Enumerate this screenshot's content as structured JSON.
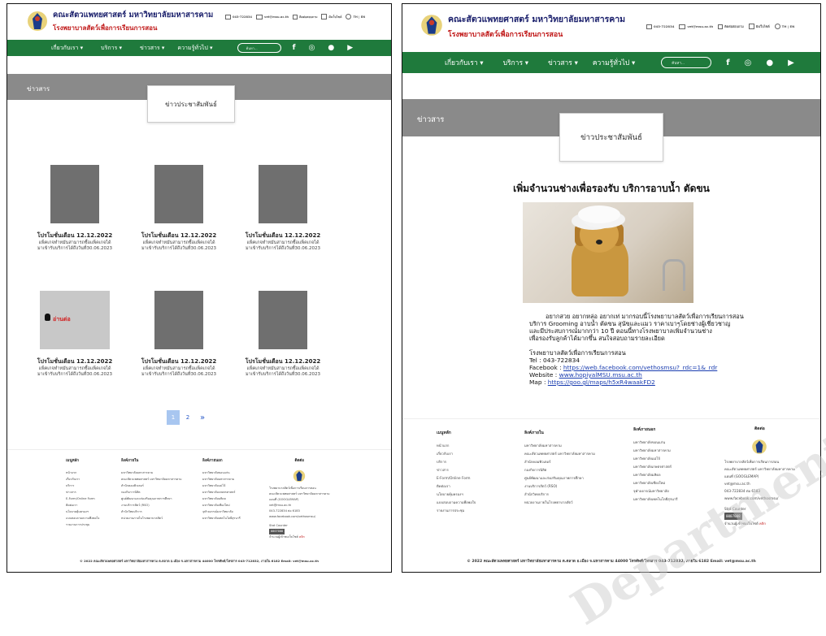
{
  "site": {
    "title": "คณะสัตวแพทยศาสตร์ มหาวิทยาลัยมหาสารคาม",
    "subtitle": "โรงพยาบาลสัตว์เพื่อการเรียนการสอน",
    "phone": "043-722834",
    "email": "vet@msu.ac.th",
    "contact": "ติดต่อสอบถาม",
    "sitemap": "ผังเว็บไซต์",
    "lang": "TH | EN"
  },
  "nav": {
    "items": [
      "เกี่ยวกับเรา ▾",
      "บริการ ▾",
      "ข่าวสาร ▾",
      "ความรู้ทั่วไป ▾"
    ],
    "search_placeholder": "ค้นหา...",
    "social": [
      "f",
      "◎",
      "●",
      "▶"
    ]
  },
  "section": {
    "label": "ข่าวสาร",
    "sub_label": "ข่าวประชาสัมพันธ์"
  },
  "news_cards": [
    {
      "title": "โปรโมชั่นเดือน 12.12.2022",
      "desc1": "แพ็คเกจทำหมันสามารถซื้อแพ็คเกจได้",
      "desc2": "มาเข้ารับบริการได้ถึงวันที่30.06.2023"
    },
    {
      "title": "โปรโมชั่นเดือน 12.12.2022",
      "desc1": "แพ็คเกจทำหมันสามารถซื้อแพ็คเกจได้",
      "desc2": "มาเข้ารับบริการได้ถึงวันที่30.06.2023"
    },
    {
      "title": "โปรโมชั่นเดือน 12.12.2022",
      "desc1": "แพ็คเกจทำหมันสามารถซื้อแพ็คเกจได้",
      "desc2": "มาเข้ารับบริการได้ถึงวันที่30.06.2023"
    },
    {
      "title": "โปรโมชั่นเดือน 12.12.2022",
      "desc1": "แพ็คเกจทำหมันสามารถซื้อแพ็คเกจได้",
      "desc2": "มาเข้ารับบริการได้ถึงวันที่30.06.2023",
      "hover_label": "อ่านต่อ"
    },
    {
      "title": "โปรโมชั่นเดือน 12.12.2022",
      "desc1": "แพ็คเกจทำหมันสามารถซื้อแพ็คเกจได้",
      "desc2": "มาเข้ารับบริการได้ถึงวันที่30.06.2023"
    },
    {
      "title": "โปรโมชั่นเดือน 12.12.2022",
      "desc1": "แพ็คเกจทำหมันสามารถซื้อแพ็คเกจได้",
      "desc2": "มาเข้ารับบริการได้ถึงวันที่30.06.2023"
    }
  ],
  "pagination": {
    "pages": [
      "1",
      "2"
    ],
    "next": "»",
    "current": "1"
  },
  "post": {
    "title": "เพิ่มจำนวนช่างเพื่อรองรับ บริการอาบน้ำ ตัดขน",
    "body1": "อยากสวย อยากหล่อ อยากเท่ มากรอบนี้โรงพยาบาลสัตว์เพื่อการเรียนการสอน",
    "body2": "บริการ Grooming อาบน้ำ ตัดขน สุนัขและแมว ราคาเบาๆโดยช่างผู้เชี่ยวชาญ",
    "body3": "และมีประสบการณ์มากกว่า 10 ปี ตอนนี้ทางโรงพยาบาลเพิ่มจำนวนช่าง",
    "body4": "เพื่อรองรับลูกค้าได้มากขึ้น สนใจสอบถามรายละเอียด",
    "org": "โรงพยาบาลสัตว์เพื่อการเรียนการสอน",
    "tel": "Tel : 043-722834",
    "facebook_label": "Facebook : ",
    "facebook": "https://web.facebook.com/vethosmsu?_rdc=1&_rdr",
    "website_label": "Website : ",
    "website": "www.hopiyalMSU.msu.ac.th",
    "map_label": "Map : ",
    "map": "https://goo.gl/maps/h5xR4waakFD2"
  },
  "footer": {
    "col1_title": "เมนูหลัก",
    "col1": [
      "หน้าแรก",
      "เกี่ยวกับเรา",
      "บริการ",
      "ข่าวสาร",
      "E-Form/Online Form",
      "ติดต่อเรา",
      "นโยบายคุ้มครองฯ",
      "แบบสอบถามความพึงพอใจ",
      "รายงานการประชุม"
    ],
    "col2_title": "ลิงค์ภายใน",
    "col2": [
      "มหาวิทยาลัยมหาสารคาม",
      "คณะสัตวแพทยศาสตร์ มหาวิทยาลัยมหาสารคาม",
      "สำนักคอมพิวเตอร์",
      "กองกิจการนิสิต",
      "ศูนย์พัฒนาและส่งเสริมคุณภาพการศึกษา",
      "งานบริการสัตว์ (RSO)",
      "สำนักวิทยบริการ",
      "หน่วยงานภายในโรงพยาบาลสัตว์"
    ],
    "col3_title": "ลิงค์ภายนอก",
    "col3": [
      "มหาวิทยาลัยขอนแก่น",
      "มหาวิทยาลัยมหาสารคาม",
      "มหาวิทยาลัยแม่โจ้",
      "มหาวิทยาลัยเกษตรศาสตร์",
      "มหาวิทยาลัยมหิดล",
      "มหาวิทยาลัยเชียงใหม่",
      "จุฬาลงกรณ์มหาวิทยาลัย",
      "มหาวิทยาลัยเทคโนโลยีสุรนารี"
    ],
    "col4_title": "ติดต่อ",
    "contact_org": "โรงพยาบาลสัตว์เพื่อการเรียนการสอน",
    "contact_fac": "คณะสัตวแพทยศาสตร์ มหาวิทยาลัยมหาสารคาม",
    "contact_items": [
      "แผนที่ (GOOGLEMAP)",
      "vet@msu.ac.th",
      "043-722834 ต่อ 6183",
      "www.facebook.com/vethosmsu/"
    ],
    "stat_label": "Stat Counter",
    "counter": "0007008",
    "visit": "จำนวนผู้เข้าชมเว็บไซต์",
    "visit_link": "คลิก",
    "copyright": "© 2022 คณะสัตวแพทยศาสตร์ มหาวิทยาลัยมหาสารคาม ต.ตลาด อ.เมือง จ.มหาสารคาม 44000 โทรศัพท์/โทรสาร 043-712832, ภายใน 6182 Email: vet@msu.ac.th"
  },
  "watermark": "Department of ... University"
}
